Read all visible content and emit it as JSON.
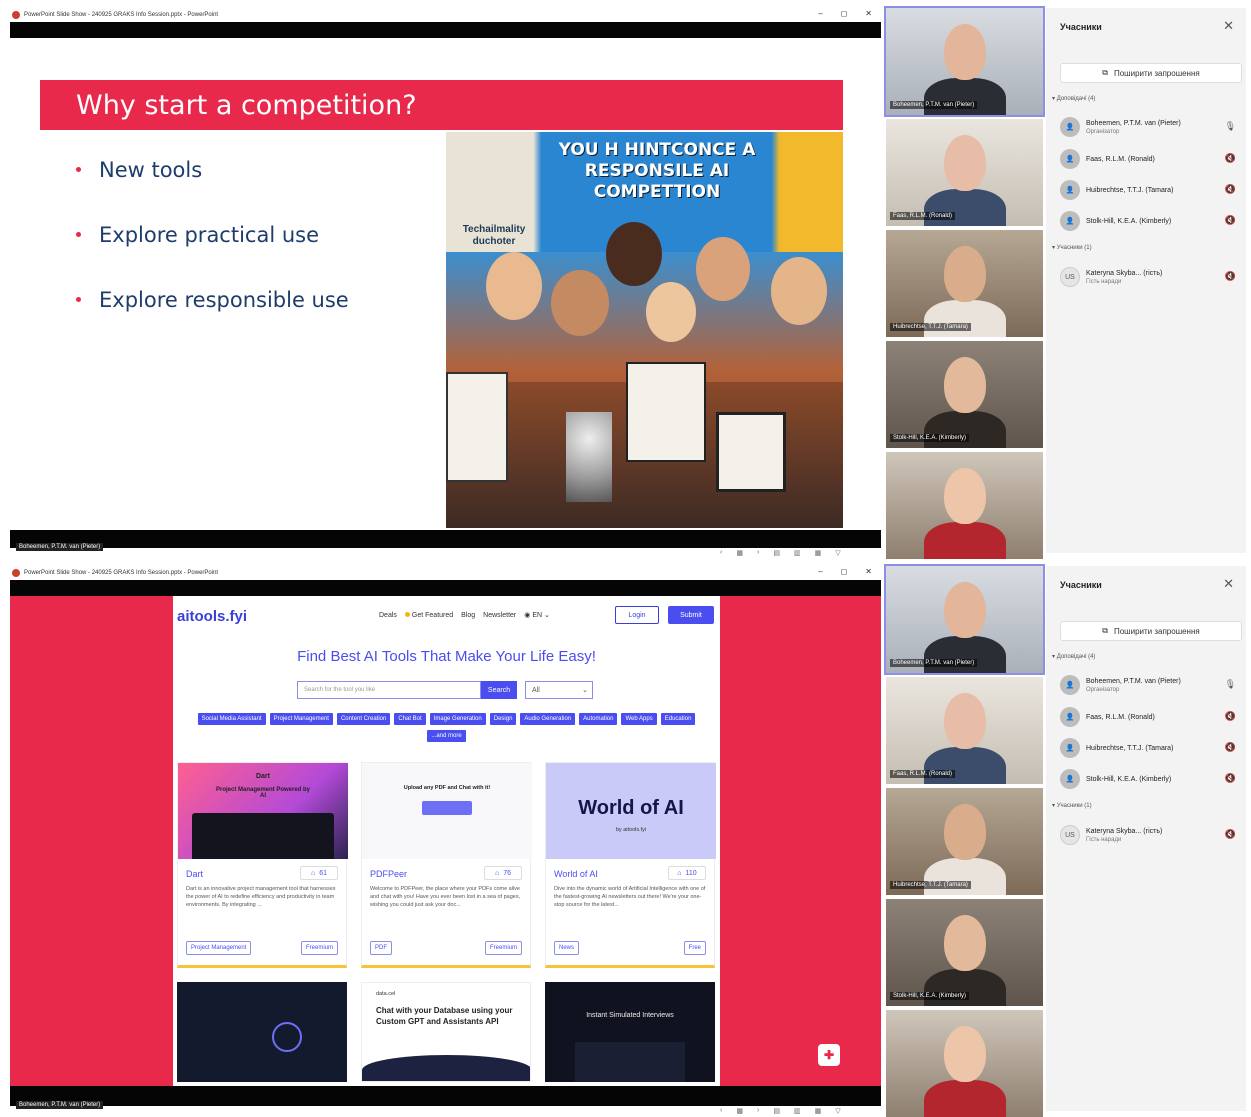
{
  "screens": [
    {
      "window_title": "PowerPoint Slide Show - 240925 GRAKS Info Session.pptx - PowerPoint",
      "presenter_label": "Boheemen, P.T.M. van (Pieter)",
      "slide": {
        "title": "Why start a competition?",
        "bullets": [
          "New tools",
          "Explore practical use",
          "Explore responsible use"
        ],
        "image_banner": "YOU H HINTCONCE A RESPONSILE AI COMPETTION",
        "image_sign": "Techailmality duchoter"
      }
    },
    {
      "window_title": "PowerPoint Slide Show - 240925 GRAKS Info Session.pptx - PowerPoint",
      "presenter_label": "Boheemen, P.T.M. van (Pieter)",
      "site": {
        "logo": "aitools.fyi",
        "nav": [
          "Deals",
          "Get Featured",
          "Blog",
          "Newsletter",
          "EN"
        ],
        "login": "Login",
        "submit": "Submit",
        "hero": "Find Best AI Tools That Make Your Life Easy!",
        "search_placeholder": "Search for the tool you like",
        "search_button": "Search",
        "filter": "All",
        "tags": [
          "Social Media Assistant",
          "Project Management",
          "Content Creation",
          "Chat Bot",
          "Image Generation",
          "Design",
          "Audio Generation",
          "Automation",
          "Web Apps",
          "Education",
          "...and more"
        ],
        "cards": [
          {
            "title": "Dart",
            "likes": "61",
            "desc": "Dart is an innovative project management tool that harnesses the power of AI to redefine efficiency and productivity in team environments. By integrating ...",
            "tag1": "Project Management",
            "tag2": "Freemium",
            "img_title": "Dart",
            "img_sub": "Project Management Powered by AI"
          },
          {
            "title": "PDFPeer",
            "likes": "76",
            "desc": "Welcome to PDFPeer, the place where your PDFs come alive and chat with you! Have you ever been lost in a sea of pages, wishing you could just ask your doc...",
            "tag1": "PDF",
            "tag2": "Freemium",
            "img_title": "Upload any PDF and Chat with it!"
          },
          {
            "title": "World of AI",
            "likes": "110",
            "desc": "Dive into the dynamic world of Artificial Intelligence with one of the fastest-growing AI newsletters out there! We're your one-stop source for the latest...",
            "tag1": "News",
            "tag2": "Free",
            "img_title": "World of AI",
            "img_sub": "by aitools.fyi"
          }
        ],
        "cards_row2": [
          {
            "text": "Chat with your Database using your Custom GPT and Assistants API",
            "brand": "data.cel"
          },
          {
            "text": "Instant Simulated Interviews"
          }
        ]
      }
    }
  ],
  "participants_panel": {
    "title": "Учасники",
    "share": "Поширити запрошення",
    "group_presenters": "Доповідачі (4)",
    "group_attendees": "Учасники (1)",
    "presenters": [
      {
        "name": "Boheemen, P.T.M. van (Pieter)",
        "role": "Організатор"
      },
      {
        "name": "Faas, R.L.M. (Ronald)",
        "role": ""
      },
      {
        "name": "Huibrechtse, T.T.J. (Tamara)",
        "role": ""
      },
      {
        "name": "Stolk-Hill, K.E.A. (Kimberly)",
        "role": ""
      }
    ],
    "attendees": [
      {
        "initials": "US",
        "name": "Kateryna Skyba... (гість)",
        "role": "Гість наради"
      }
    ]
  },
  "video_tiles": [
    {
      "name": "Boheemen, P.T.M. van (Pieter)"
    },
    {
      "name": "Faas, R.L.M. (Ronald)"
    },
    {
      "name": "Huibrechtse, T.T.J. (Tamara)"
    },
    {
      "name": "Stolk-Hill, K.E.A. (Kimberly)"
    },
    {
      "name": ""
    }
  ],
  "colors": {
    "accent": "#e8294b",
    "brand": "#4a4df0",
    "title_text": "#1f3d6b"
  }
}
